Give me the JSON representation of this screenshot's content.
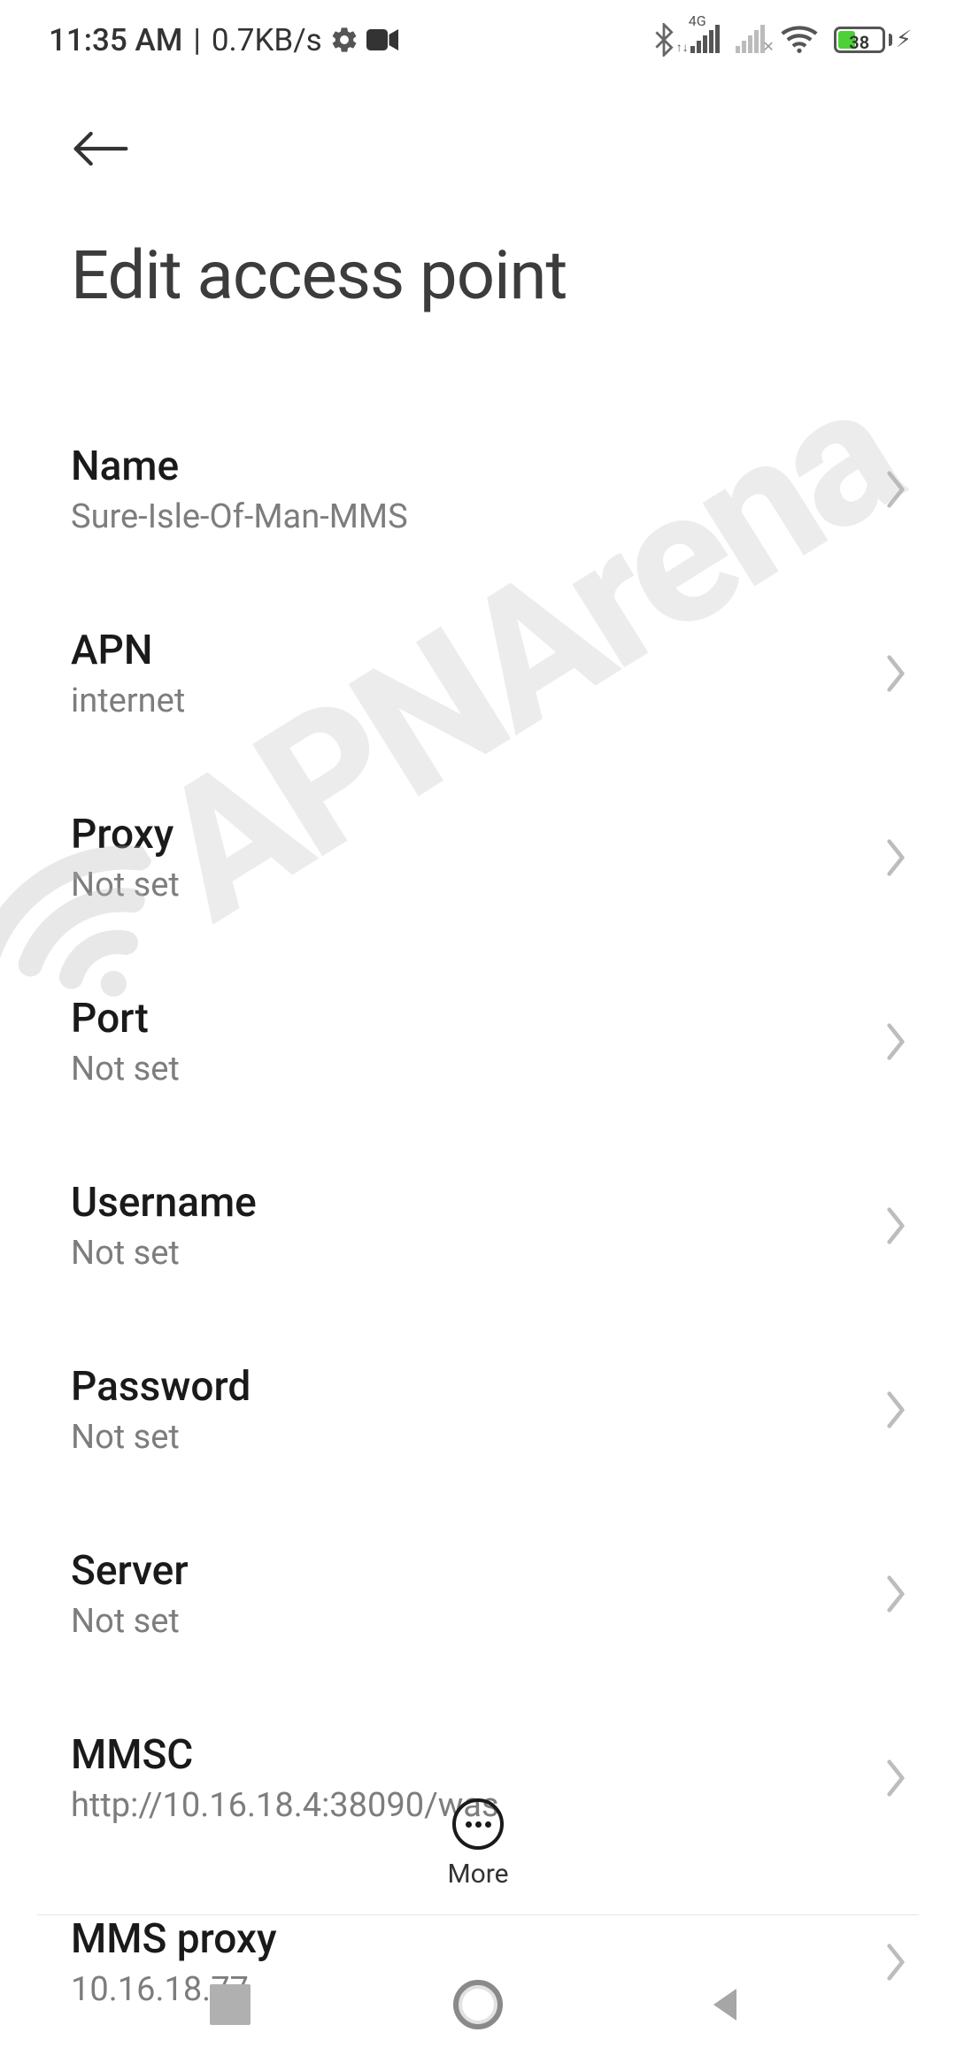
{
  "statusbar": {
    "time": "11:35 AM",
    "separator": "|",
    "dataRate": "0.7KB/s",
    "signal4gLabel": "4G",
    "batteryPercent": "38"
  },
  "header": {
    "title": "Edit access point"
  },
  "settings": [
    {
      "title": "Name",
      "value": "Sure-Isle-Of-Man-MMS"
    },
    {
      "title": "APN",
      "value": "internet"
    },
    {
      "title": "Proxy",
      "value": "Not set"
    },
    {
      "title": "Port",
      "value": "Not set"
    },
    {
      "title": "Username",
      "value": "Not set"
    },
    {
      "title": "Password",
      "value": "Not set"
    },
    {
      "title": "Server",
      "value": "Not set"
    },
    {
      "title": "MMSC",
      "value": "http://10.16.18.4:38090/was"
    },
    {
      "title": "MMS proxy",
      "value": "10.16.18.77"
    }
  ],
  "moreAction": {
    "label": "More"
  },
  "watermarkText": "APNArena"
}
